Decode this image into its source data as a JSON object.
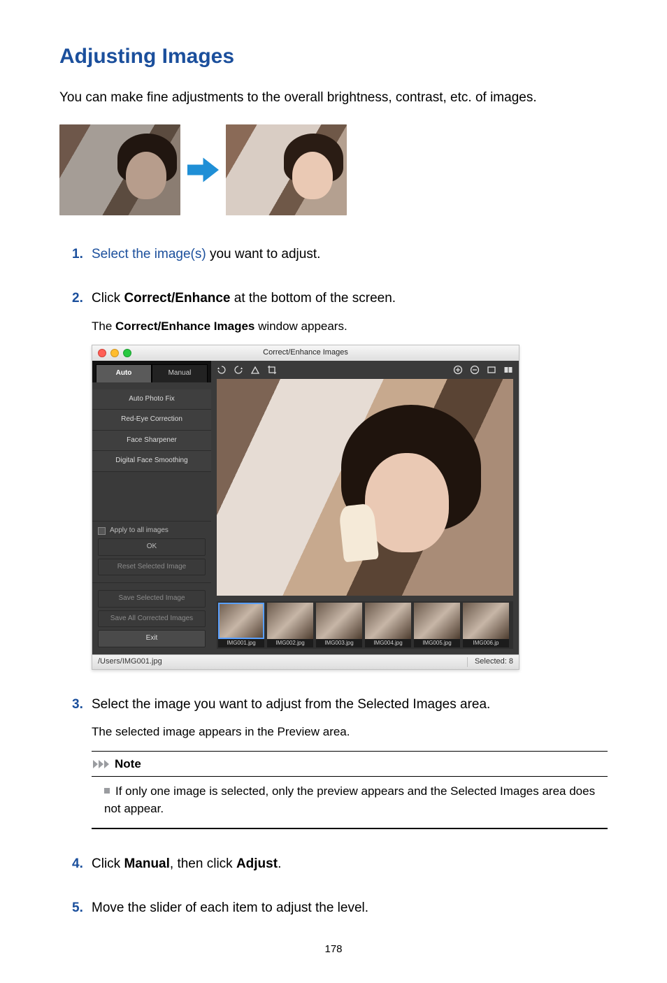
{
  "title": "Adjusting Images",
  "intro": "You can make fine adjustments to the overall brightness, contrast, etc. of images.",
  "steps": {
    "s1_link": "Select the image(s)",
    "s1_tail": " you want to adjust.",
    "s2_a": "Click ",
    "s2_b": "Correct/Enhance",
    "s2_c": " at the bottom of the screen.",
    "s2_sub_a": "The ",
    "s2_sub_b": "Correct/Enhance Images",
    "s2_sub_c": " window appears.",
    "s3": "Select the image you want to adjust from the Selected Images area.",
    "s3_sub": "The selected image appears in the Preview area.",
    "s4_a": "Click ",
    "s4_b": "Manual",
    "s4_c": ", then click ",
    "s4_d": "Adjust",
    "s4_e": ".",
    "s5": "Move the slider of each item to adjust the level."
  },
  "note": {
    "label": "Note",
    "body": "If only one image is selected, only the preview appears and the Selected Images area does not appear."
  },
  "app": {
    "title": "Correct/Enhance Images",
    "tabs": {
      "auto": "Auto",
      "manual": "Manual"
    },
    "side_items": [
      "Auto Photo Fix",
      "Red-Eye Correction",
      "Face Sharpener",
      "Digital Face Smoothing"
    ],
    "apply_all": "Apply to all images",
    "ok": "OK",
    "reset": "Reset Selected Image",
    "save_sel": "Save Selected Image",
    "save_all": "Save All Corrected Images",
    "exit": "Exit",
    "thumbs": [
      "IMG001.jpg",
      "IMG002.jpg",
      "IMG003.jpg",
      "IMG004.jpg",
      "IMG005.jpg",
      "IMG006.jp"
    ],
    "status_path": "/Users/IMG001.jpg",
    "status_sel": "Selected: 8"
  },
  "page_number": "178"
}
